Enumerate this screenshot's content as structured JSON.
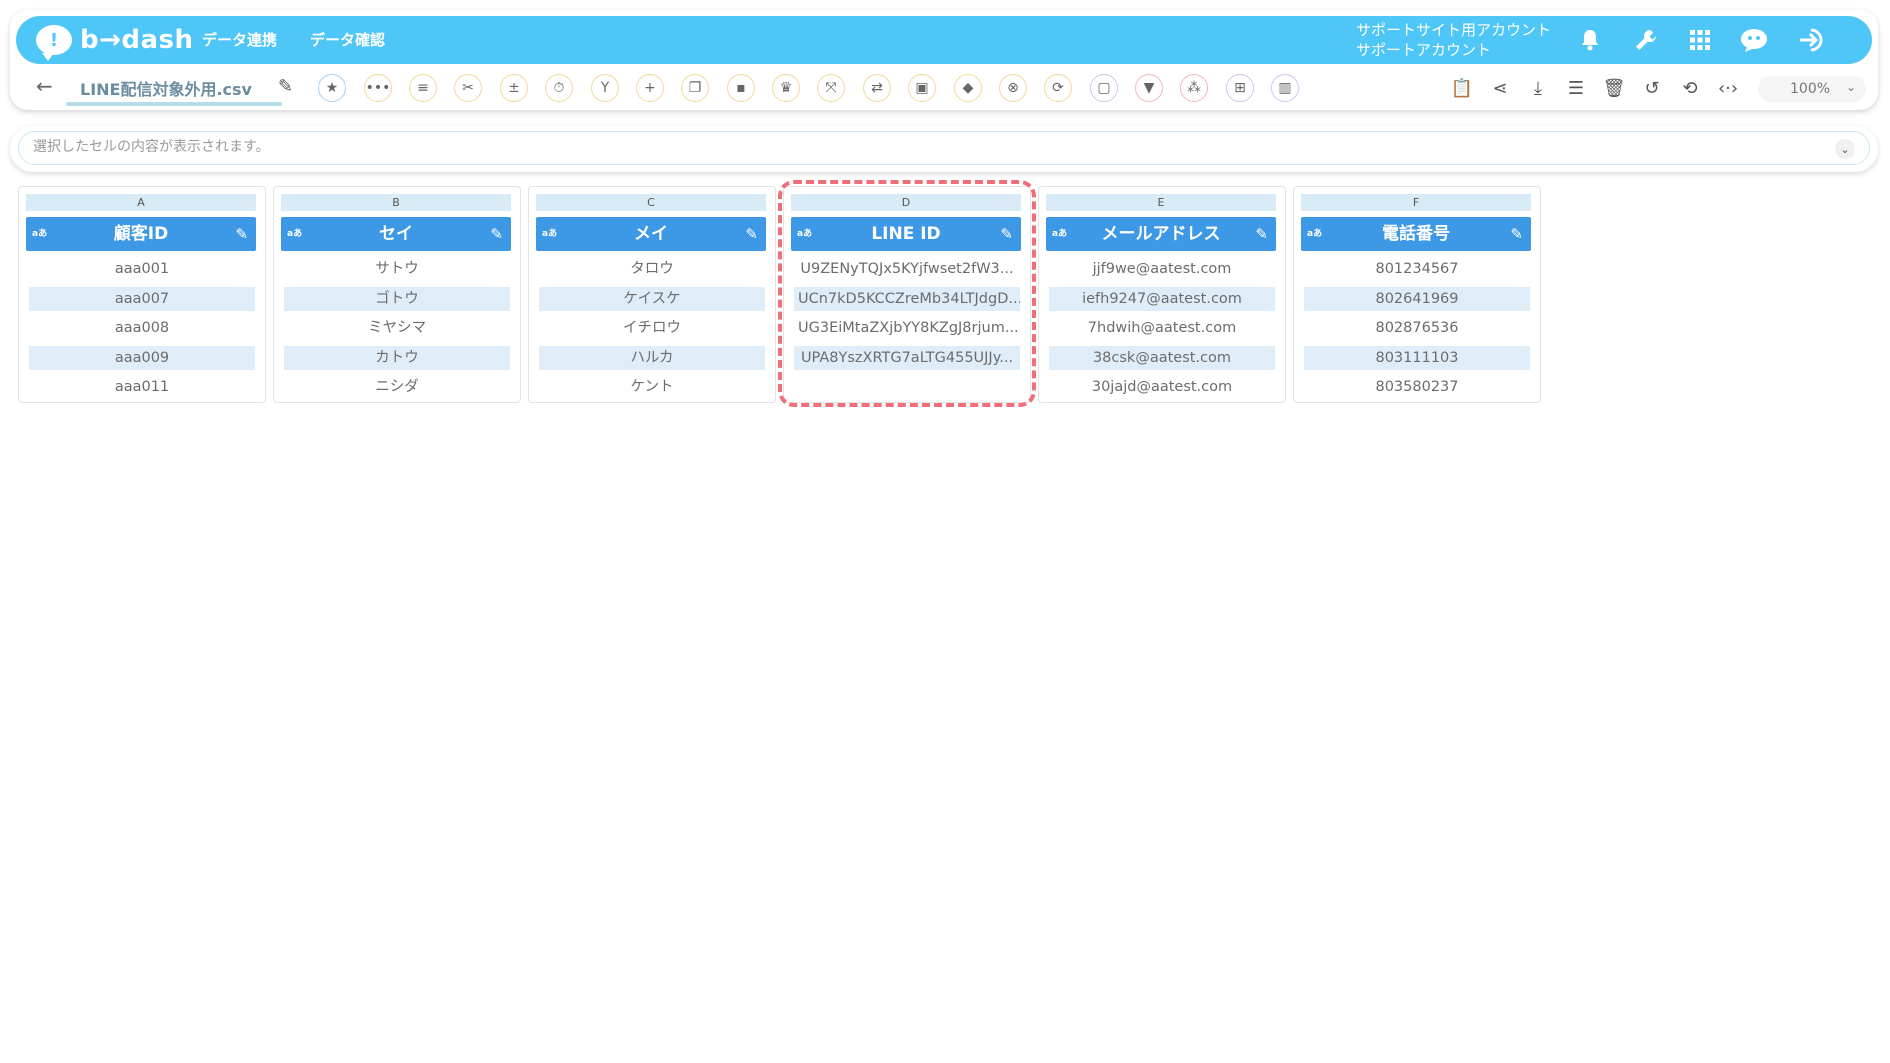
{
  "header": {
    "logo_text": "b→dash",
    "nav": [
      {
        "label": "データ連携"
      },
      {
        "label": "データ確認"
      }
    ],
    "account_line1": "サポートサイト用アカウント",
    "account_line2": "サポートアカウント",
    "icons": [
      "bell-icon",
      "wrench-icon",
      "grid-apps-icon",
      "chat-mascot-icon",
      "logout-icon"
    ]
  },
  "toolbar": {
    "file_name": "LINE配信対象外用.csv",
    "zoom": "100%",
    "tools": [
      "star-icon",
      "more-icon",
      "list-icon",
      "cut-icon",
      "calc-icon",
      "timer-icon",
      "merge-icon",
      "add-icon",
      "copy-icon",
      "delete-icon",
      "crown-icon",
      "expand-icon",
      "repeat-icon",
      "lock-icon",
      "bag-icon",
      "clear-icon",
      "replace-icon",
      "frame-icon",
      "filter-icon",
      "group-icon",
      "table-icon",
      "columns-icon"
    ],
    "right_tools": [
      "clipboard-icon",
      "share-icon",
      "download-icon",
      "list-view-icon",
      "trash-icon",
      "history-icon",
      "refresh-icon",
      "code-icon"
    ]
  },
  "cell_bar": {
    "placeholder": "選択したセルの内容が表示されます。"
  },
  "columns": [
    {
      "letter": "A",
      "name": "顧客ID",
      "type": "aあ",
      "rows": [
        "aaa001",
        "aaa007",
        "aaa008",
        "aaa009",
        "aaa011"
      ]
    },
    {
      "letter": "B",
      "name": "セイ",
      "type": "aあ",
      "rows": [
        "サトウ",
        "ゴトウ",
        "ミヤシマ",
        "カトウ",
        "ニシダ"
      ]
    },
    {
      "letter": "C",
      "name": "メイ",
      "type": "aあ",
      "rows": [
        "タロウ",
        "ケイスケ",
        "イチロウ",
        "ハルカ",
        "ケント"
      ]
    },
    {
      "letter": "D",
      "name": "LINE ID",
      "type": "aあ",
      "rows": [
        "U9ZENyTQJx5KYjfwset2fW3...",
        "UCn7kD5KCCZreMb34LTJdgD...",
        "UG3EiMtaZXjbYY8KZgJ8rjum...",
        "UPA8YszXRTG7aLTG455UJJy...",
        ""
      ]
    },
    {
      "letter": "E",
      "name": "メールアドレス",
      "type": "aあ",
      "rows": [
        "jjf9we@aatest.com",
        "iefh9247@aatest.com",
        "7hdwih@aatest.com",
        "38csk@aatest.com",
        "30jajd@aatest.com"
      ]
    },
    {
      "letter": "F",
      "name": "電話番号",
      "type": "aあ",
      "rows": [
        "801234567",
        "802641969",
        "802876536",
        "803111103",
        "803580237"
      ]
    }
  ],
  "colors": {
    "topbar": "#4ec6f7",
    "column_header": "#3d98e6",
    "alt_row": "#deedf8",
    "highlight": "#ee6f78"
  }
}
